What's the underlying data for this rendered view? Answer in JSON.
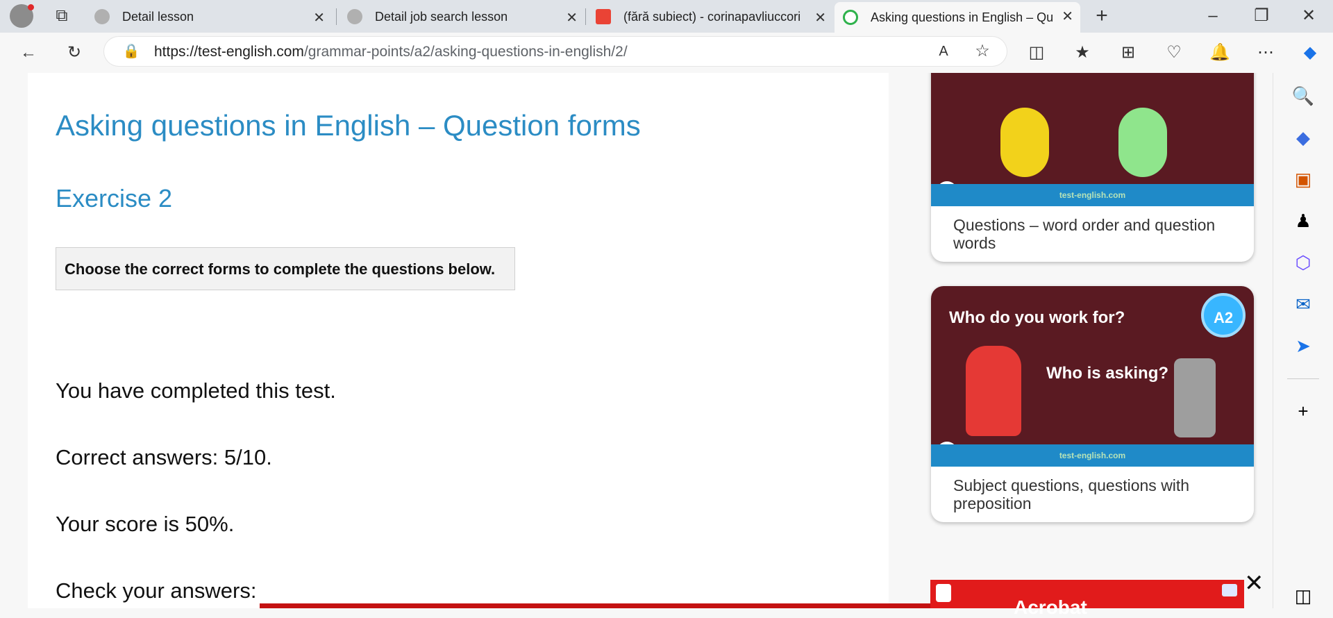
{
  "tabs": [
    {
      "label": "Detail lesson"
    },
    {
      "label": "Detail job search lesson"
    },
    {
      "label": "(fără subiect) - corinapavliuccori"
    },
    {
      "label": "Asking questions in English – Qu"
    }
  ],
  "address": {
    "host": "https://test-english.com",
    "path": "/grammar-points/a2/asking-questions-in-english/2/"
  },
  "page": {
    "title": "Asking questions in English – Question forms",
    "exercise": "Exercise 2",
    "instruction": "Choose the correct forms to complete the questions below.",
    "results": [
      "You have completed this test.",
      "Correct answers: 5/10.",
      "Your score is 50%.",
      "Check your answers:"
    ]
  },
  "sidebar": {
    "cards": [
      {
        "title": "Questions – word order and question words",
        "thumb_text": "test-english.com"
      },
      {
        "title": "Subject questions, questions with preposition",
        "thumb_text": "test-english.com",
        "thumb_heading": "Who do you work for?",
        "thumb_sub": "Who is asking?",
        "badge": "A2"
      }
    ]
  },
  "ad": {
    "text": "Acrobat"
  }
}
